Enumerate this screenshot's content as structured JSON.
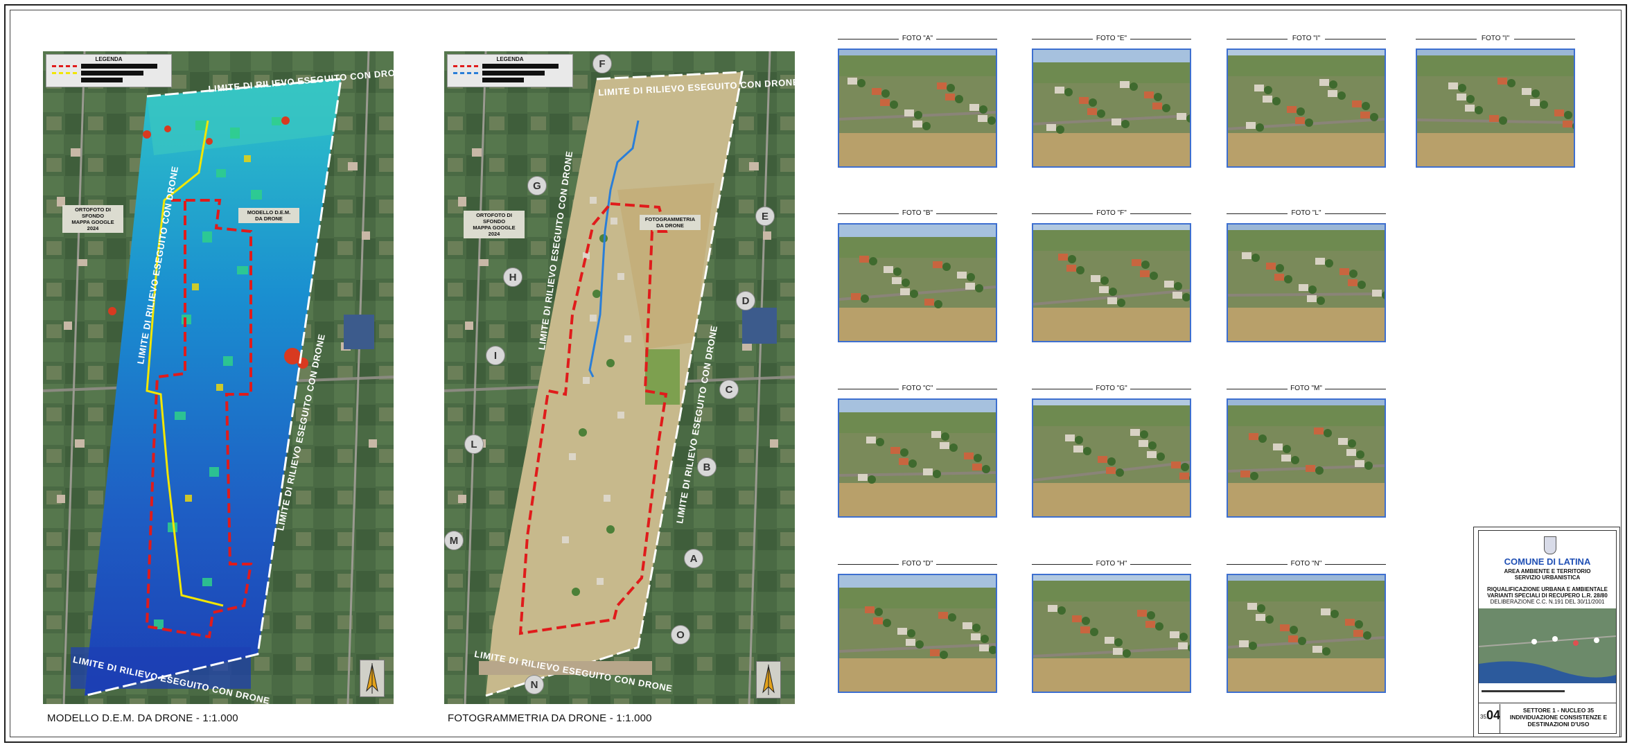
{
  "left_map": {
    "caption": "MODELLO D.E.M. DA DRONE - 1:1.000",
    "legend_title": "LEGENDA",
    "label_background": "ORTOFOTO DI SFONDO\nMAPPA GOOGLE 2024",
    "label_model": "MODELLO D.E.M.\nDA DRONE",
    "edge_label": "LIMITE DI RILIEVO ESEGUITO CON DRONE"
  },
  "right_map": {
    "caption": "FOTOGRAMMETRIA DA DRONE - 1:1.000",
    "legend_title": "LEGENDA",
    "label_background": "ORTOFOTO DI SFONDO\nMAPPA GOOGLE 2024",
    "label_model": "FOTOGRAMMETRIA\nDA DRONE",
    "edge_label": "LIMITE DI RILIEVO ESEGUITO CON DRONE",
    "markers": [
      "F",
      "G",
      "E",
      "H",
      "D",
      "I",
      "C",
      "L",
      "B",
      "M",
      "A",
      "O",
      "N"
    ]
  },
  "photos": [
    {
      "title": "FOTO \"A\""
    },
    {
      "title": "FOTO \"E\""
    },
    {
      "title": "FOTO \"I\""
    },
    {
      "title": "FOTO \"I\""
    },
    {
      "title": "FOTO \"B\""
    },
    {
      "title": "FOTO \"F\""
    },
    {
      "title": "FOTO \"L\""
    },
    {
      "title": "FOTO \"C\""
    },
    {
      "title": "FOTO \"G\""
    },
    {
      "title": "FOTO \"M\""
    },
    {
      "title": "FOTO \"D\""
    },
    {
      "title": "FOTO \"H\""
    },
    {
      "title": "FOTO \"N\""
    }
  ],
  "title_block": {
    "municipality": "COMUNE DI LATINA",
    "department": "AREA AMBIENTE E TERRITORIO",
    "service": "SERVIZIO URBANISTICA",
    "project_1": "RIQUALIFICAZIONE URBANA E AMBIENTALE",
    "project_2": "VARIANTI SPECIALI DI RECUPERO L.R. 28/80",
    "deliberation": "DELIBERAZIONE C.C. N.191 DEL 30/11/2001",
    "sheet_prefix": "35.",
    "sheet_number": "04",
    "sector": "SETTORE 1 - NUCLEO 35",
    "sheet_title": "INDIVIDUAZIONE CONSISTENZE E DESTINAZIONI D'USO"
  },
  "colors": {
    "photo_border": "#3d6fd0",
    "boundary_red": "#e01b1b",
    "boundary_yellow": "#f2e600",
    "boundary_blue": "#2a7ed8",
    "municipality_blue": "#1f4fb4"
  }
}
